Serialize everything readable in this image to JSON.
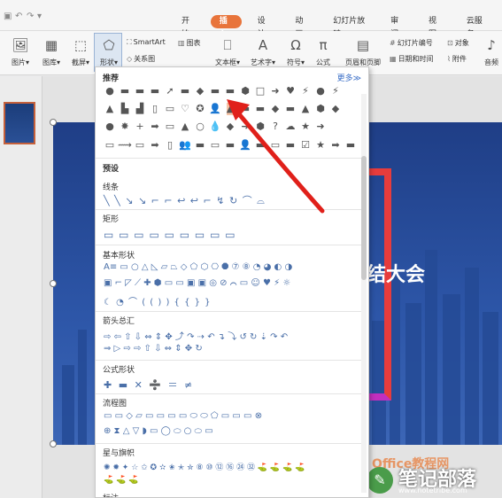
{
  "quick_access": {
    "icons": [
      "save-icon",
      "undo-icon",
      "redo-icon"
    ],
    "dropdown": "▾"
  },
  "menu_tabs": [
    "开始",
    "插入",
    "设计",
    "动画",
    "幻灯片放映",
    "审阅",
    "视图",
    "云服务"
  ],
  "active_tab": "插入",
  "ribbon": {
    "picture": "图片▾",
    "gallery": "图库▾",
    "screenshot": "截屏▾",
    "shape": "形状▾",
    "smartart": "SmartArt",
    "chart": "图表",
    "relation": "关系图",
    "textbox": "文本框▾",
    "wordart": "艺术字▾",
    "symbol": "符号▾",
    "formula": "公式",
    "header_footer": "页眉和页脚",
    "slide_number": "幻灯片编号",
    "object": "对象",
    "datetime": "日期和时间",
    "attachment": "附件",
    "audio": "音频"
  },
  "shapes_panel": {
    "recommended": "推荐",
    "more": "更多≫",
    "preset": "预设",
    "sections": {
      "lines": "线条",
      "rectangles": "矩形",
      "basic": "基本形状",
      "arrows": "箭头总汇",
      "formula": "公式形状",
      "flowchart": "流程图",
      "stars": "星与旗帜",
      "callouts": "标注"
    },
    "recommended_rows": [
      [
        "●",
        "▬",
        "▬",
        "▬",
        "➚",
        "▬",
        "◆",
        "▬",
        "▬",
        "⬢",
        "□",
        "➜",
        "♥",
        "⚡",
        "●",
        "⚡"
      ],
      [
        "▲",
        "▙",
        "▟",
        "▯",
        "▭",
        "♡",
        "✪",
        "👤",
        "▲",
        "▬",
        "▬",
        "◆",
        "▬",
        "▲",
        "⬢",
        "◆"
      ],
      [
        "●",
        "✸",
        "+",
        "➡",
        "▭",
        "▲",
        "○",
        "💧",
        "◆",
        "➜",
        "⬢",
        "?",
        "☁",
        "★",
        "➜"
      ],
      [
        "▭",
        "⟿",
        "▭",
        "➡",
        "▯",
        "👥",
        "▬",
        "▭",
        "▬",
        "👤",
        "▬",
        "▭",
        "▬",
        "☑",
        "★",
        "➡",
        "▬"
      ]
    ],
    "line_row": "╲ ╲ ↘ ↘ ⌐ ⌐ ↩ ↩ ⌐ ↯ ↻ ⌒ ⌓",
    "rect_row": "▭ ▭ ▭ ▭ ▭ ▭ ▭ ▭ ▭",
    "basic_rows": [
      "A≡ ▭ ○ △ ◺ ▱ ⏢ ◇ ⬠ ⬡ ⎔ ⯃ ⑦ ⑧ ◔ ◕ ◐ ◑",
      "▣ ⌐ ◸ ⟋ ✚ ⬢ ▭ ▭ ▣ ▣ ◎ ⊘ ⌒ ▭ ☺ ♥ ⚡ ☼",
      "☾ ◔ ⌒ ( ( ) ) { { } }"
    ],
    "arrow_rows": [
      "⇨ ⇦ ⇧ ⇩ ⇔ ⇕ ✥ ⤴ ↷ ⇢ ↶ ↴ ⤵ ↺ ↻ ⇣ ↷ ↶",
      "⇒ ▷ ⇨ ⇨ ⇧ ⇩ ⇔ ⇕ ✥ ↻"
    ],
    "formula_row": "✚ ▬ ✕ ➗ ＝ ≠",
    "flow_rows": [
      "▭ ▭ ◇ ▱ ▭ ▭ ▭ ▭ ⬭ ⬭ ⬠ ▭ ▭ ▭ ⊗",
      "⊕ ⧗ △ ▽ ◗ ▭ ◯ ⬭ ○ ⬭ ▭"
    ],
    "star_rows": [
      "✺ ✹ ✦ ☆ ✩ ✪ ✫ ✬ ✭ ✮ ⑧ ⑩ ⑫ ⑯ ㉔ ㉜ ⛳ ⛳ ⛳ ⛳",
      "⛳ ⛳ ⛳"
    ]
  },
  "slide": {
    "title": "结大会"
  },
  "watermark": {
    "brand": "Office教程网",
    "name": "笔记部落",
    "url": "www.notetribe.com"
  }
}
